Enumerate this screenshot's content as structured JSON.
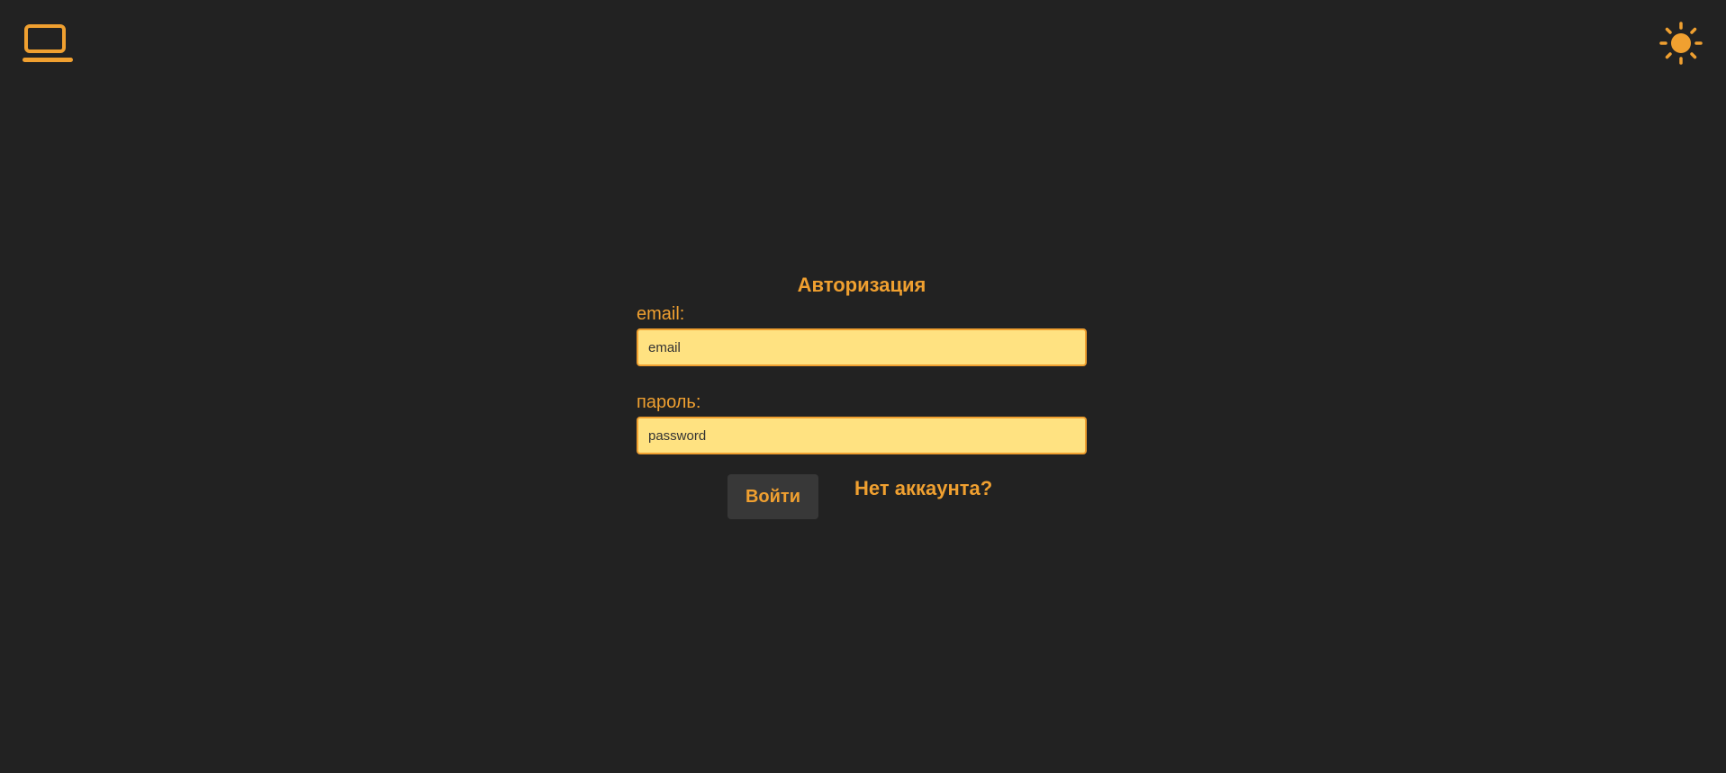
{
  "header": {
    "left_icon": "laptop-icon",
    "right_icon": "sun-icon"
  },
  "login_form": {
    "title": "Авторизация",
    "email_label": "email:",
    "email_placeholder": "email",
    "password_label": "пароль:",
    "password_placeholder": "password",
    "submit_label": "Войти",
    "signup_link": "Нет аккаунта?"
  },
  "colors": {
    "background": "#222222",
    "accent": "#f0a030",
    "input_fill": "#ffe281",
    "button_fill": "#383838"
  }
}
